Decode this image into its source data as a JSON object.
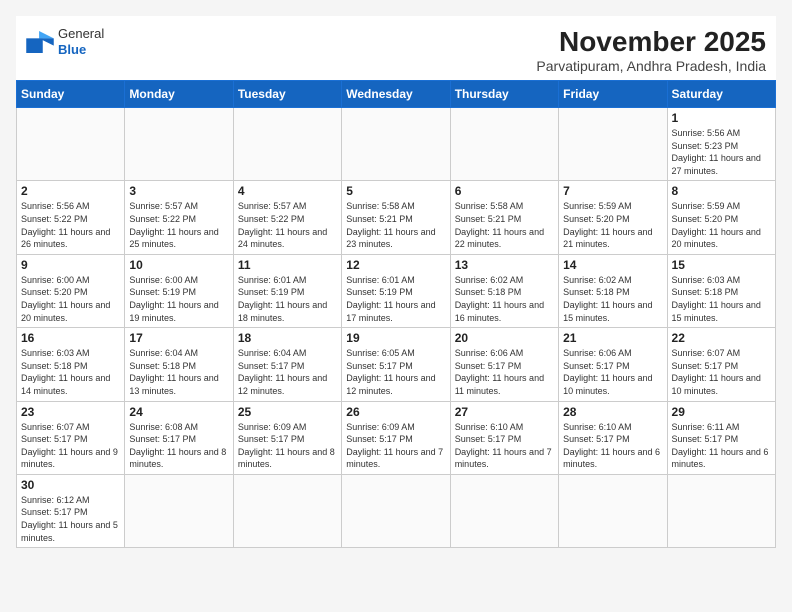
{
  "header": {
    "logo_general": "General",
    "logo_blue": "Blue",
    "month_title": "November 2025",
    "location": "Parvatipuram, Andhra Pradesh, India"
  },
  "weekdays": [
    "Sunday",
    "Monday",
    "Tuesday",
    "Wednesday",
    "Thursday",
    "Friday",
    "Saturday"
  ],
  "weeks": [
    [
      {
        "day": "",
        "text": ""
      },
      {
        "day": "",
        "text": ""
      },
      {
        "day": "",
        "text": ""
      },
      {
        "day": "",
        "text": ""
      },
      {
        "day": "",
        "text": ""
      },
      {
        "day": "",
        "text": ""
      },
      {
        "day": "1",
        "text": "Sunrise: 5:56 AM\nSunset: 5:23 PM\nDaylight: 11 hours and 27 minutes."
      }
    ],
    [
      {
        "day": "2",
        "text": "Sunrise: 5:56 AM\nSunset: 5:22 PM\nDaylight: 11 hours and 26 minutes."
      },
      {
        "day": "3",
        "text": "Sunrise: 5:57 AM\nSunset: 5:22 PM\nDaylight: 11 hours and 25 minutes."
      },
      {
        "day": "4",
        "text": "Sunrise: 5:57 AM\nSunset: 5:22 PM\nDaylight: 11 hours and 24 minutes."
      },
      {
        "day": "5",
        "text": "Sunrise: 5:58 AM\nSunset: 5:21 PM\nDaylight: 11 hours and 23 minutes."
      },
      {
        "day": "6",
        "text": "Sunrise: 5:58 AM\nSunset: 5:21 PM\nDaylight: 11 hours and 22 minutes."
      },
      {
        "day": "7",
        "text": "Sunrise: 5:59 AM\nSunset: 5:20 PM\nDaylight: 11 hours and 21 minutes."
      },
      {
        "day": "8",
        "text": "Sunrise: 5:59 AM\nSunset: 5:20 PM\nDaylight: 11 hours and 20 minutes."
      }
    ],
    [
      {
        "day": "9",
        "text": "Sunrise: 6:00 AM\nSunset: 5:20 PM\nDaylight: 11 hours and 20 minutes."
      },
      {
        "day": "10",
        "text": "Sunrise: 6:00 AM\nSunset: 5:19 PM\nDaylight: 11 hours and 19 minutes."
      },
      {
        "day": "11",
        "text": "Sunrise: 6:01 AM\nSunset: 5:19 PM\nDaylight: 11 hours and 18 minutes."
      },
      {
        "day": "12",
        "text": "Sunrise: 6:01 AM\nSunset: 5:19 PM\nDaylight: 11 hours and 17 minutes."
      },
      {
        "day": "13",
        "text": "Sunrise: 6:02 AM\nSunset: 5:18 PM\nDaylight: 11 hours and 16 minutes."
      },
      {
        "day": "14",
        "text": "Sunrise: 6:02 AM\nSunset: 5:18 PM\nDaylight: 11 hours and 15 minutes."
      },
      {
        "day": "15",
        "text": "Sunrise: 6:03 AM\nSunset: 5:18 PM\nDaylight: 11 hours and 15 minutes."
      }
    ],
    [
      {
        "day": "16",
        "text": "Sunrise: 6:03 AM\nSunset: 5:18 PM\nDaylight: 11 hours and 14 minutes."
      },
      {
        "day": "17",
        "text": "Sunrise: 6:04 AM\nSunset: 5:18 PM\nDaylight: 11 hours and 13 minutes."
      },
      {
        "day": "18",
        "text": "Sunrise: 6:04 AM\nSunset: 5:17 PM\nDaylight: 11 hours and 12 minutes."
      },
      {
        "day": "19",
        "text": "Sunrise: 6:05 AM\nSunset: 5:17 PM\nDaylight: 11 hours and 12 minutes."
      },
      {
        "day": "20",
        "text": "Sunrise: 6:06 AM\nSunset: 5:17 PM\nDaylight: 11 hours and 11 minutes."
      },
      {
        "day": "21",
        "text": "Sunrise: 6:06 AM\nSunset: 5:17 PM\nDaylight: 11 hours and 10 minutes."
      },
      {
        "day": "22",
        "text": "Sunrise: 6:07 AM\nSunset: 5:17 PM\nDaylight: 11 hours and 10 minutes."
      }
    ],
    [
      {
        "day": "23",
        "text": "Sunrise: 6:07 AM\nSunset: 5:17 PM\nDaylight: 11 hours and 9 minutes."
      },
      {
        "day": "24",
        "text": "Sunrise: 6:08 AM\nSunset: 5:17 PM\nDaylight: 11 hours and 8 minutes."
      },
      {
        "day": "25",
        "text": "Sunrise: 6:09 AM\nSunset: 5:17 PM\nDaylight: 11 hours and 8 minutes."
      },
      {
        "day": "26",
        "text": "Sunrise: 6:09 AM\nSunset: 5:17 PM\nDaylight: 11 hours and 7 minutes."
      },
      {
        "day": "27",
        "text": "Sunrise: 6:10 AM\nSunset: 5:17 PM\nDaylight: 11 hours and 7 minutes."
      },
      {
        "day": "28",
        "text": "Sunrise: 6:10 AM\nSunset: 5:17 PM\nDaylight: 11 hours and 6 minutes."
      },
      {
        "day": "29",
        "text": "Sunrise: 6:11 AM\nSunset: 5:17 PM\nDaylight: 11 hours and 6 minutes."
      }
    ],
    [
      {
        "day": "30",
        "text": "Sunrise: 6:12 AM\nSunset: 5:17 PM\nDaylight: 11 hours and 5 minutes."
      },
      {
        "day": "",
        "text": ""
      },
      {
        "day": "",
        "text": ""
      },
      {
        "day": "",
        "text": ""
      },
      {
        "day": "",
        "text": ""
      },
      {
        "day": "",
        "text": ""
      },
      {
        "day": "",
        "text": ""
      }
    ]
  ]
}
